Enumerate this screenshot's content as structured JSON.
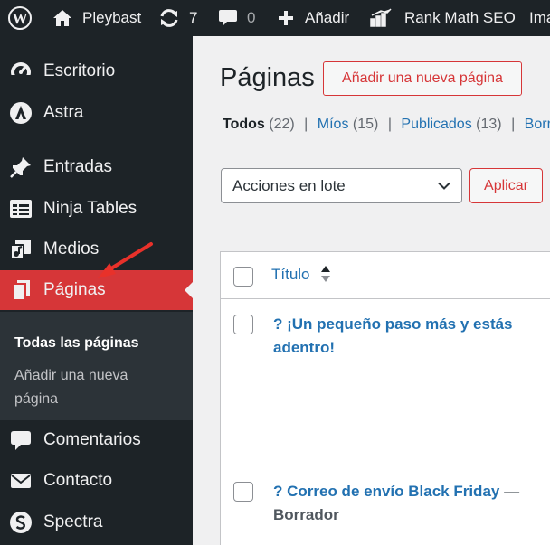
{
  "adminbar": {
    "site_name": "Pleybast",
    "updates_count": "7",
    "comments_count": "0",
    "add_new": "Añadir",
    "rank_math": "Rank Math SEO",
    "truncated_item": "Ima"
  },
  "sidebar": {
    "items": [
      {
        "label": "Escritorio",
        "icon": "dashboard-icon"
      },
      {
        "label": "Astra",
        "icon": "astra-icon"
      },
      {
        "label": "Entradas",
        "icon": "pushpin-icon"
      },
      {
        "label": "Ninja Tables",
        "icon": "table-icon"
      },
      {
        "label": "Medios",
        "icon": "media-icon"
      },
      {
        "label": "Páginas",
        "icon": "pages-icon",
        "active": true
      },
      {
        "label": "Comentarios",
        "icon": "comment-icon"
      },
      {
        "label": "Contacto",
        "icon": "mail-icon"
      },
      {
        "label": "Spectra",
        "icon": "spectra-icon"
      }
    ],
    "submenu": {
      "all_pages": "Todas las páginas",
      "add_new_line1": "Añadir una nueva",
      "add_new_line2": "página"
    }
  },
  "main": {
    "title": "Páginas",
    "add_new_button": "Añadir una nueva página",
    "filters": {
      "all_label": "Todos",
      "all_count": "(22)",
      "mine_label": "Míos",
      "mine_count": "(15)",
      "published_label": "Publicados",
      "published_count": "(13)",
      "drafts_partial": "Borr"
    },
    "bulk_actions": {
      "selected": "Acciones en lote",
      "apply": "Aplicar"
    },
    "table": {
      "column_title": "Título",
      "rows": [
        {
          "title": "? ¡Un pequeño paso más y estás adentro!",
          "state": ""
        },
        {
          "title": "? Correo de envío Black Friday",
          "dash": "—",
          "state": "Borrador"
        }
      ]
    }
  },
  "colors": {
    "adminbar_bg": "#1d2327",
    "accent_red": "#d63638",
    "link_blue": "#2271b1",
    "arrow_red": "#e8312a"
  }
}
